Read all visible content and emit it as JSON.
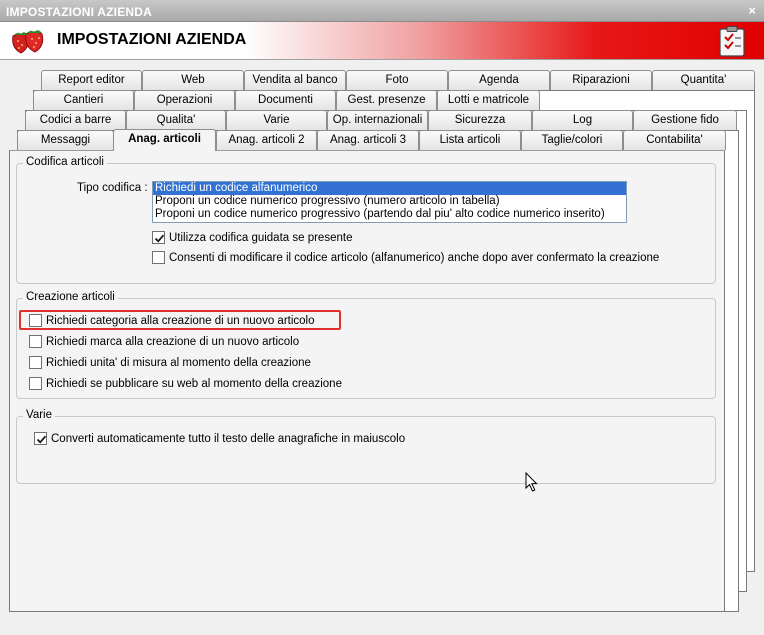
{
  "window": {
    "title": "IMPOSTAZIONI AZIENDA",
    "close_glyph": "×"
  },
  "header": {
    "title": "IMPOSTAZIONI AZIENDA",
    "logo_icon": "strawberries-icon",
    "action_icon": "clipboard-check-icon"
  },
  "tabs": {
    "row1": [
      "Report editor",
      "Web",
      "Vendita al banco",
      "Foto",
      "Agenda",
      "Riparazioni",
      "Quantita'"
    ],
    "row2": [
      "Cantieri",
      "Operazioni",
      "Documenti",
      "Gest. presenze",
      "Lotti e matricole"
    ],
    "row3": [
      "Codici a barre",
      "Qualita'",
      "Varie",
      "Op. internazionali",
      "Sicurezza",
      "Log",
      "Gestione fido"
    ],
    "row4": [
      "Messaggi",
      "Anag. articoli",
      "Anag. articoli 2",
      "Anag. articoli 3",
      "Lista articoli",
      "Taglie/colori",
      "Contabilita'"
    ],
    "active": "Anag. articoli"
  },
  "codifica": {
    "legend": "Codifica articoli",
    "tipo_label": "Tipo codifica :",
    "options": [
      "Richiedi un codice alfanumerico",
      "Proponi un codice numerico progressivo (numero articolo in tabella)",
      "Proponi un codice numerico progressivo (partendo dal piu' alto codice numerico inserito)"
    ],
    "selected_index": 0,
    "checkboxes": [
      {
        "label": "Utilizza codifica guidata se presente",
        "checked": true
      },
      {
        "label": "Consenti di modificare il codice articolo (alfanumerico) anche dopo aver confermato la creazione",
        "checked": false
      }
    ]
  },
  "creazione": {
    "legend": "Creazione articoli",
    "checkboxes": [
      {
        "label": "Richiedi categoria alla creazione di un nuovo articolo",
        "checked": false
      },
      {
        "label": "Richiedi marca alla creazione di un nuovo articolo",
        "checked": false
      },
      {
        "label": "Richiedi unita' di misura al momento della creazione",
        "checked": false
      },
      {
        "label": "Richiedi se pubblicare su web al momento della creazione",
        "checked": false
      }
    ]
  },
  "varie": {
    "legend": "Varie",
    "checkboxes": [
      {
        "label": "Converti automaticamente tutto il testo delle anagrafiche in maiuscolo",
        "checked": true
      }
    ]
  },
  "colors": {
    "accent_red": "#e00000",
    "selection": "#3372d2",
    "highlight": "#e03030"
  }
}
